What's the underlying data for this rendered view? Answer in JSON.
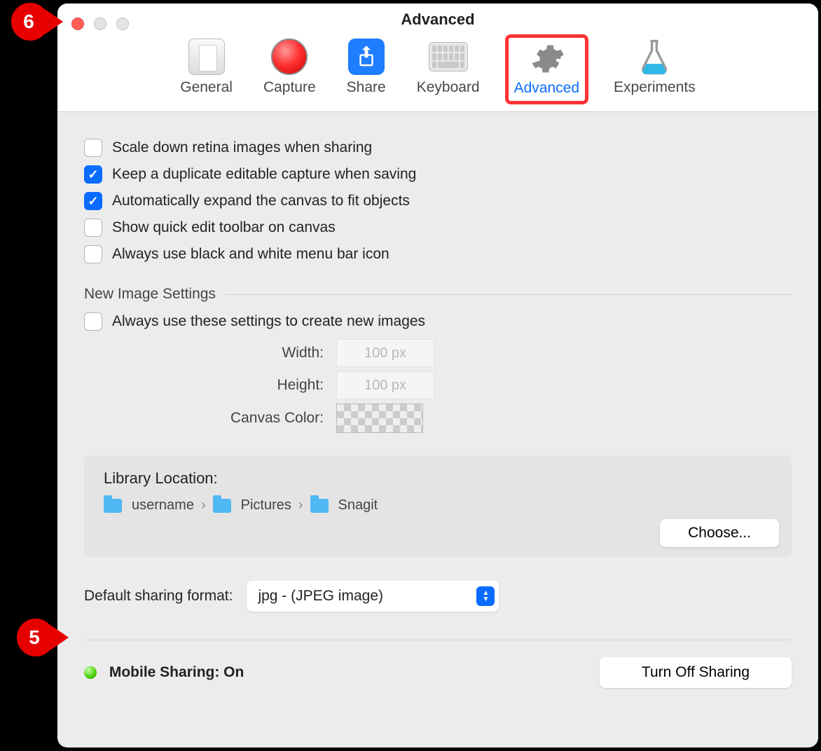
{
  "window": {
    "title": "Advanced"
  },
  "callouts": {
    "top": "6",
    "format": "5"
  },
  "toolbar": {
    "general": "General",
    "capture": "Capture",
    "share": "Share",
    "keyboard": "Keyboard",
    "advanced": "Advanced",
    "experiments": "Experiments"
  },
  "options": {
    "scale_retina": "Scale down retina images when sharing",
    "keep_duplicate": "Keep a duplicate editable capture when saving",
    "auto_expand": "Automatically expand the canvas to fit objects",
    "quick_edit": "Show quick edit toolbar on canvas",
    "bw_menu": "Always use black and white menu bar icon"
  },
  "new_image": {
    "section_title": "New Image Settings",
    "always_use": "Always use these settings to create new images",
    "width_label": "Width:",
    "width_value": "100 px",
    "height_label": "Height:",
    "height_value": "100 px",
    "canvas_color_label": "Canvas Color:"
  },
  "library": {
    "title": "Library Location:",
    "path": [
      "username",
      "Pictures",
      "Snagit"
    ],
    "choose_label": "Choose..."
  },
  "sharing_format": {
    "label": "Default sharing format:",
    "value": "jpg - (JPEG image)"
  },
  "mobile": {
    "label": "Mobile Sharing: On",
    "button": "Turn Off Sharing"
  }
}
